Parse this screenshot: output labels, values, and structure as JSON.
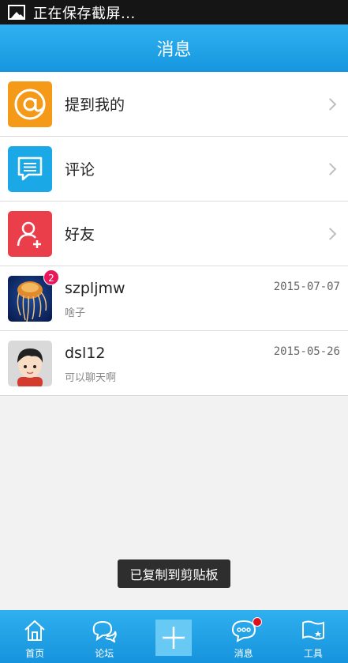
{
  "status_bar": {
    "text": "正在保存截屏..."
  },
  "header": {
    "title": "消息"
  },
  "menu": [
    {
      "label": "提到我的",
      "icon": "at-icon",
      "color": "#f59a18"
    },
    {
      "label": "评论",
      "icon": "comment-icon",
      "color": "#1aa9e6"
    },
    {
      "label": "好友",
      "icon": "add-friend-icon",
      "color": "#ea3f4b"
    }
  ],
  "conversations": [
    {
      "name": "szpljmw",
      "preview": "啥子",
      "date": "2015-07-07",
      "badge": "2",
      "avatar": "jellyfish-avatar"
    },
    {
      "name": "dsl12",
      "preview": "可以聊天啊",
      "date": "2015-05-26",
      "avatar": "cartoon-boy-avatar"
    }
  ],
  "toast": {
    "text": "已复制到剪贴板"
  },
  "tabbar": {
    "home": "首页",
    "forum": "论坛",
    "messages": "消息",
    "tools": "工具"
  },
  "colors": {
    "accent": "#1aa2e8",
    "badge": "#e8185a",
    "notification_dot": "#e0101e"
  }
}
